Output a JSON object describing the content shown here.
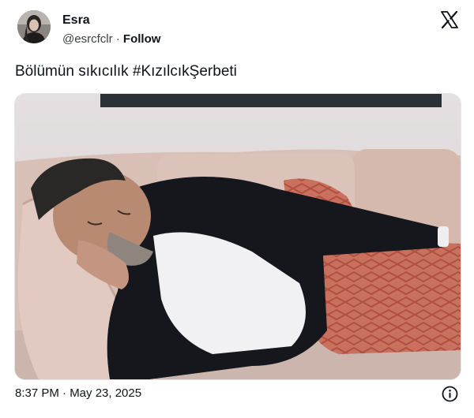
{
  "author": {
    "name": "Esra",
    "handle": "@esrcfclr",
    "separator": "·",
    "follow_label": "Follow"
  },
  "tweet": {
    "text": "Bölümün sıkıcılık #KızılcıkŞerbeti",
    "timestamp": "8:37 PM · May 23, 2025"
  },
  "icons": {
    "logo": "x-logo-icon",
    "info": "info-icon"
  },
  "colors": {
    "text": "#0f1419",
    "secondary": "#536471",
    "background": "#ffffff"
  }
}
